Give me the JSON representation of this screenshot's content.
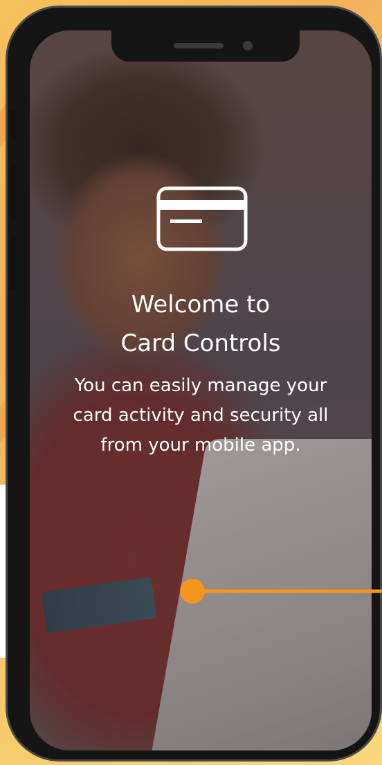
{
  "screen": {
    "title_line1": "Welcome to",
    "title_line2": "Card Controls",
    "description": "You can easily manage your card activity and security all from your mobile app."
  },
  "icons": {
    "main": "credit-card-icon"
  },
  "colors": {
    "accent": "#f7941d",
    "text": "#ffffff",
    "frame": "#151515",
    "background": "#f7c25c"
  }
}
